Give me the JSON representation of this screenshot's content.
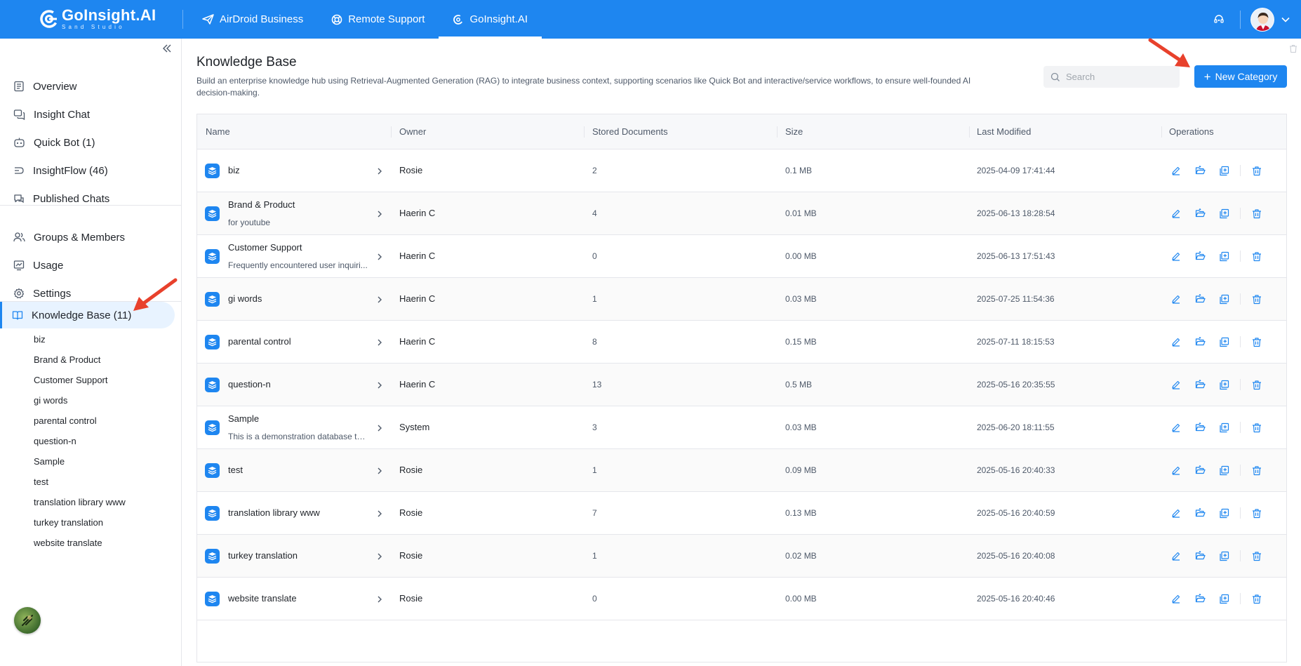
{
  "brand": {
    "name": "GoInsight.AI",
    "sub": "Sand Studio"
  },
  "top_nav": [
    {
      "label": "AirDroid Business",
      "icon": "paper-plane-icon"
    },
    {
      "label": "Remote Support",
      "icon": "lifebuoy-icon"
    },
    {
      "label": "GoInsight.AI",
      "icon": "goinsight-icon",
      "active": true
    }
  ],
  "sidebar": {
    "items": [
      {
        "label": "Overview",
        "icon": "overview-icon"
      },
      {
        "label": "Insight Chat",
        "icon": "chat-icon"
      },
      {
        "label": "Quick Bot (1)",
        "icon": "bot-icon"
      },
      {
        "label": "InsightFlow (46)",
        "icon": "flow-icon"
      },
      {
        "label": "Published Chats",
        "icon": "published-chats-icon"
      }
    ],
    "items2": [
      {
        "label": "Groups & Members",
        "icon": "members-icon"
      },
      {
        "label": "Usage",
        "icon": "usage-icon"
      },
      {
        "label": "Settings",
        "icon": "settings-icon"
      }
    ],
    "knowledge_base": {
      "label": "Knowledge Base (11)",
      "icon": "book-icon"
    },
    "kb_children": [
      "biz",
      "Brand & Product",
      "Customer Support",
      "gi words",
      "parental control",
      "question-n",
      "Sample",
      "test",
      "translation library www",
      "turkey translation",
      "website translate"
    ]
  },
  "main": {
    "title": "Knowledge Base",
    "description": "Build an enterprise knowledge hub using Retrieval-Augmented Generation (RAG) to integrate business context, supporting scenarios like Quick Bot and interactive/service workflows, to ensure well-founded AI decision-making.",
    "search_placeholder": "Search",
    "new_button": "New Category"
  },
  "table": {
    "columns": [
      "Name",
      "Owner",
      "Stored Documents",
      "Size",
      "Last Modified",
      "Operations"
    ],
    "rows": [
      {
        "name": "biz",
        "desc": "",
        "owner": "Rosie",
        "docs": "2",
        "size": "0.1 MB",
        "modified": "2025-04-09 17:41:44"
      },
      {
        "name": "Brand & Product",
        "desc": "for youtube",
        "owner": "Haerin C",
        "docs": "4",
        "size": "0.01 MB",
        "modified": "2025-06-13 18:28:54"
      },
      {
        "name": "Customer Support",
        "desc": "Frequently encountered user inquiri...",
        "owner": "Haerin C",
        "docs": "0",
        "size": "0.00 MB",
        "modified": "2025-06-13 17:51:43"
      },
      {
        "name": "gi words",
        "desc": "",
        "owner": "Haerin C",
        "docs": "1",
        "size": "0.03 MB",
        "modified": "2025-07-25 11:54:36"
      },
      {
        "name": "parental control",
        "desc": "",
        "owner": "Haerin C",
        "docs": "8",
        "size": "0.15 MB",
        "modified": "2025-07-11 18:15:53"
      },
      {
        "name": "question-n",
        "desc": "",
        "owner": "Haerin C",
        "docs": "13",
        "size": "0.5 MB",
        "modified": "2025-05-16 20:35:55"
      },
      {
        "name": "Sample",
        "desc": "This is a demonstration database th...",
        "owner": "System",
        "docs": "3",
        "size": "0.03 MB",
        "modified": "2025-06-20 18:11:55"
      },
      {
        "name": "test",
        "desc": "",
        "owner": "Rosie",
        "docs": "1",
        "size": "0.09 MB",
        "modified": "2025-05-16 20:40:33"
      },
      {
        "name": "translation library www",
        "desc": "",
        "owner": "Rosie",
        "docs": "7",
        "size": "0.13 MB",
        "modified": "2025-05-16 20:40:59"
      },
      {
        "name": "turkey translation",
        "desc": "",
        "owner": "Rosie",
        "docs": "1",
        "size": "0.02 MB",
        "modified": "2025-05-16 20:40:08"
      },
      {
        "name": "website translate",
        "desc": "",
        "owner": "Rosie",
        "docs": "0",
        "size": "0.00 MB",
        "modified": "2025-05-16 20:40:46"
      }
    ],
    "operation_icons": [
      "edit-icon",
      "folder-open-icon",
      "copy-add-icon",
      "delete-icon"
    ]
  },
  "colors": {
    "primary": "#1e86f0",
    "annotation_arrow": "#e8412c"
  }
}
